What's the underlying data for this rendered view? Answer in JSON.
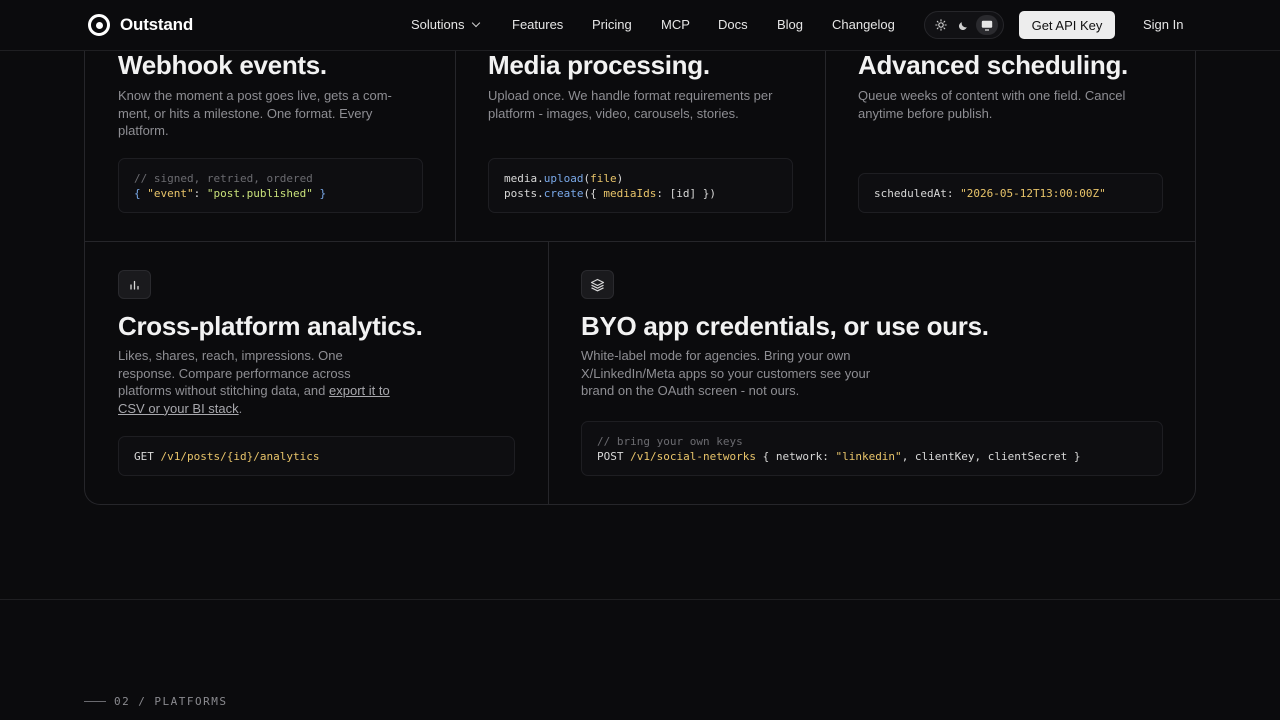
{
  "nav": {
    "brand": "Outstand",
    "links": [
      {
        "label": "Solutions",
        "has_menu": true
      },
      {
        "label": "Features"
      },
      {
        "label": "Pricing"
      },
      {
        "label": "MCP"
      },
      {
        "label": "Docs"
      },
      {
        "label": "Blog"
      },
      {
        "label": "Changelog"
      }
    ],
    "theme_options": [
      "sun-icon",
      "moon-icon",
      "monitor-icon"
    ],
    "theme_selected": "monitor-icon",
    "cta": "Get API Key",
    "signin": "Sign In"
  },
  "features": {
    "webhook": {
      "title": "Webhook events.",
      "desc": "Know the moment a post goes live, gets a com-ment, or hits a milestone. One format. Every platform.",
      "code_comment": "// signed, retried, ordered",
      "code_open": "{ ",
      "code_key": "\"event\"",
      "code_colon": ": ",
      "code_value": "\"post.published\"",
      "code_close": " }"
    },
    "media": {
      "title": "Media processing.",
      "desc": "Upload once. We handle format requirements per platform - images, video, carousels, stories.",
      "line1_obj": "media",
      "line1_dot": ".",
      "line1_fn": "upload",
      "line1_open": "(",
      "line1_arg": "file",
      "line1_close": ")",
      "line2_obj": "posts",
      "line2_dot": ".",
      "line2_fn": "create",
      "line2_open": "({ ",
      "line2_key": "mediaIds",
      "line2_rest": ": [id] })"
    },
    "scheduling": {
      "title": "Advanced scheduling.",
      "desc": "Queue weeks of content with one field. Cancel anytime before publish.",
      "code_key": "scheduledAt: ",
      "code_value": "\"2026-05-12T13:00:00Z\""
    },
    "analytics": {
      "icon": "bar-chart-icon",
      "title": "Cross-platform analytics.",
      "desc_prefix": "Likes, shares, reach, impressions. One response. Compare performance across platforms without stitching data, and ",
      "desc_link": "export it to CSV or your BI stack",
      "desc_suffix": ".",
      "code_method": "GET ",
      "code_path": "/v1/posts/{id}/analytics"
    },
    "byo": {
      "icon": "layers-icon",
      "title": "BYO app credentials, or use ours.",
      "desc": "White-label mode for agencies. Bring your own X/LinkedIn/Meta apps so your customers see your brand on the OAuth screen - not ours.",
      "code_comment": "// bring your own keys",
      "code_method": "POST ",
      "code_path": "/v1/social-networks",
      "code_mid": " { network: ",
      "code_value": "\"linkedin\"",
      "code_end": ", clientKey, clientSecret }"
    }
  },
  "section": {
    "number": "02",
    "sep": "/",
    "name": "PLATFORMS"
  },
  "colors": {
    "background": "#0b0b0d",
    "border": "#26262a",
    "string": "#e8c46a",
    "function": "#79a8e8",
    "muted": "#8e8e93"
  }
}
